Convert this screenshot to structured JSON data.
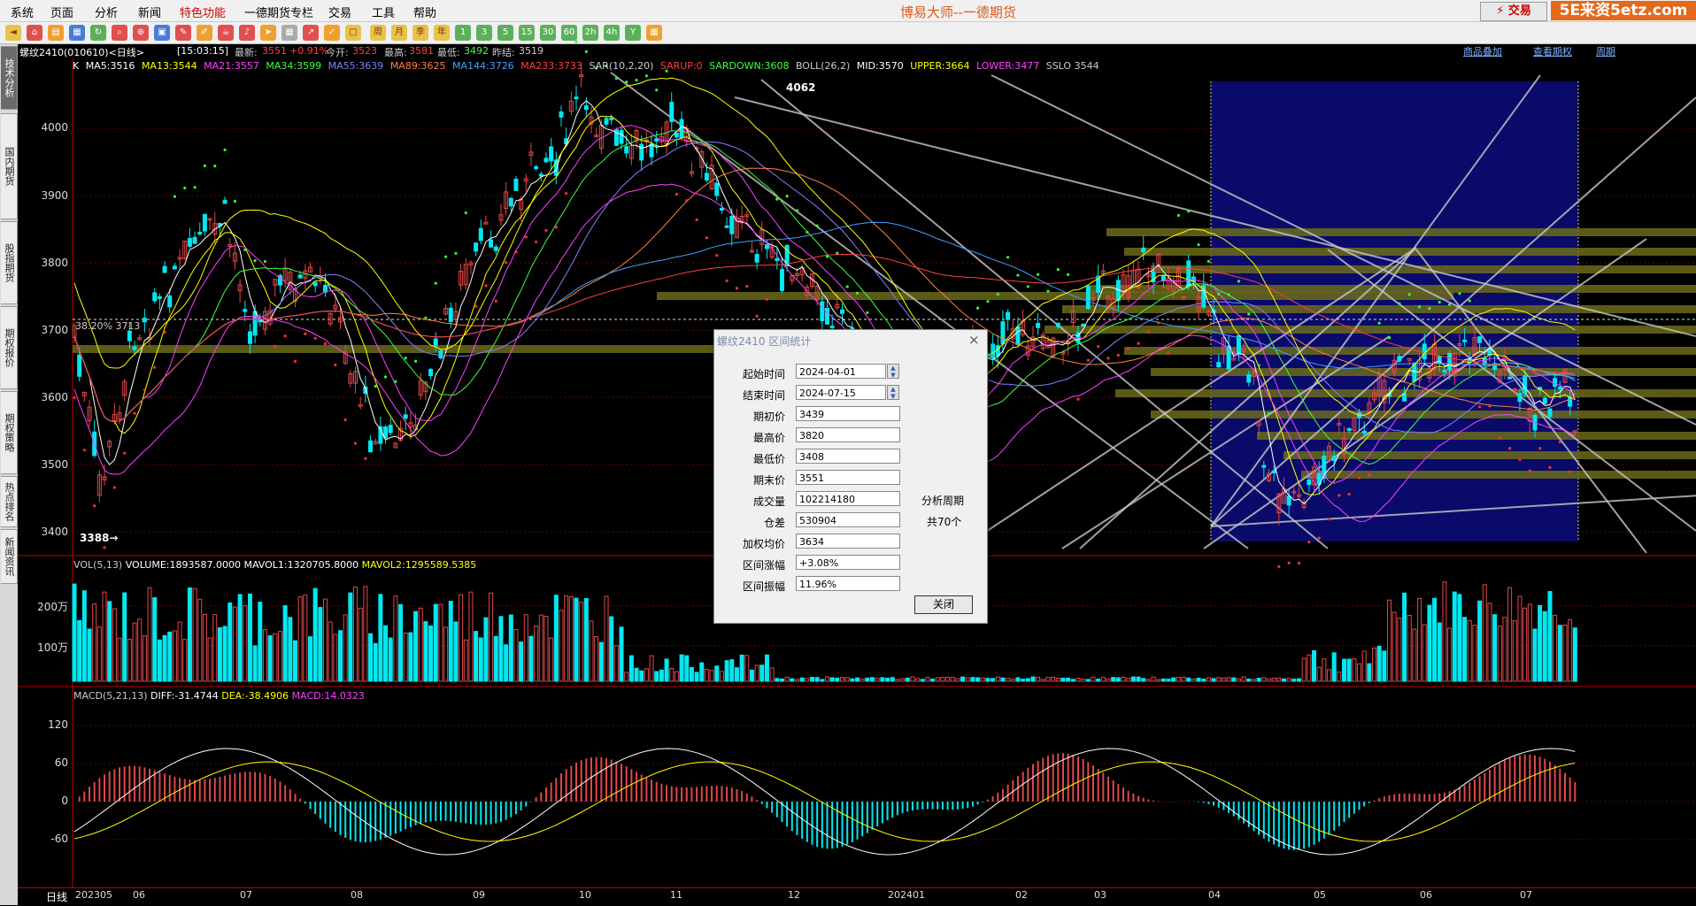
{
  "menu": {
    "items": [
      "系统",
      "页面",
      "分析",
      "新闻",
      "特色功能",
      "一德期货专栏",
      "交易",
      "工具",
      "帮助"
    ],
    "title": "博易大师--一德期货",
    "trade_button": "⚡ 交易",
    "brand": "5E来资5etz.com"
  },
  "toolbar": {
    "icons": [
      "back",
      "home",
      "book",
      "calendar",
      "refresh",
      "search",
      "zoom",
      "window",
      "pen",
      "pencil",
      "cup",
      "bell",
      "pointer",
      "table",
      "chart",
      "tick",
      "square",
      "周",
      "月",
      "季",
      "年",
      "1",
      "3",
      "5",
      "15",
      "30",
      "60",
      "2h",
      "4h",
      "Y",
      "grid"
    ]
  },
  "sidebar": {
    "tabs": [
      "技术分析",
      "国内期货",
      "股指期货",
      "期权报价",
      "期权策略",
      "热点排名",
      "新闻资讯"
    ]
  },
  "infobar": {
    "contract": "螺纹2410(010610)<日线>",
    "time": "[15:03:15]",
    "latest_label": "最新:",
    "latest": "3551",
    "change": "+0.91%",
    "open_label": "今开:",
    "open": "3523",
    "high_label": "最高:",
    "high": "3581",
    "low_label": "最低:",
    "low": "3492",
    "prev_label": "昨结:",
    "prev": "3519",
    "links": [
      "商品叠加",
      "查看期权",
      "周期"
    ]
  },
  "indicators": {
    "k_label": "K",
    "ma5": "MA5:3516",
    "ma13": "MA13:3544",
    "ma21": "MA21:3557",
    "ma34": "MA34:3599",
    "ma55": "MA55:3639",
    "ma89": "MA89:3625",
    "ma144": "MA144:3726",
    "ma233": "MA233:3733",
    "sar": "SAR(10,2,20)",
    "sarup": "SARUP:0",
    "sardown": "SARDOWN:3608",
    "boll": "BOLL(26,2)",
    "mid": "MID:3570",
    "upper": "UPPER:3664",
    "lower": "LOWER:3477",
    "sslo": "SSLO 3544",
    "fib_label": "38.20% 3713",
    "max_label": "4062",
    "min_label": "3388→"
  },
  "volume": {
    "header": "VOL(5,13)",
    "volume": "VOLUME:1893587.0000",
    "mavol1": "MAVOL1:1320705.8000",
    "mavol2": "MAVOL2:1295589.5385",
    "y_labels": [
      "200万",
      "100万"
    ]
  },
  "macd": {
    "header": "MACD(5,21,13)",
    "diff": "DIFF:-31.4744",
    "dea": "DEA:-38.4906",
    "macd": "MACD:14.0323",
    "y_labels": [
      "120",
      "60",
      "0",
      "-60"
    ]
  },
  "price_axis": {
    "labels": [
      "4000",
      "3900",
      "3800",
      "3700",
      "3600",
      "3500",
      "3400"
    ]
  },
  "x_axis": {
    "period": "日线",
    "labels": [
      "202305",
      "06",
      "07",
      "08",
      "09",
      "10",
      "11",
      "12",
      "202401",
      "02",
      "03",
      "04",
      "05",
      "06",
      "07"
    ]
  },
  "dialog": {
    "title": "螺纹2410 区间统计",
    "close": "×",
    "rows": [
      {
        "label": "起始时间",
        "value": "2024-04-01"
      },
      {
        "label": "结束时间",
        "value": "2024-07-15"
      },
      {
        "label": "期初价",
        "value": "3439"
      },
      {
        "label": "最高价",
        "value": "3820"
      },
      {
        "label": "最低价",
        "value": "3408"
      },
      {
        "label": "期末价",
        "value": "3551"
      },
      {
        "label": "成交量",
        "value": "102214180"
      },
      {
        "label": "仓差",
        "value": "530904"
      },
      {
        "label": "加权均价",
        "value": "3634"
      },
      {
        "label": "区间涨幅",
        "value": "+3.08%"
      },
      {
        "label": "区间振幅",
        "value": "11.96%"
      }
    ],
    "period_label": "分析周期",
    "period_count": "共70个",
    "ok": "关闭"
  },
  "colors": {
    "up": "#e04848",
    "down": "#00e8f0",
    "ma5": "#ffffff",
    "ma13": "#ffff00",
    "ma21": "#ff40ff",
    "ma34": "#40ff40",
    "ma55": "#8080ff",
    "ma89": "#ff8040",
    "ma144": "#40a0ff",
    "ma233": "#ff4040",
    "highlight": "#0a0a6a"
  }
}
